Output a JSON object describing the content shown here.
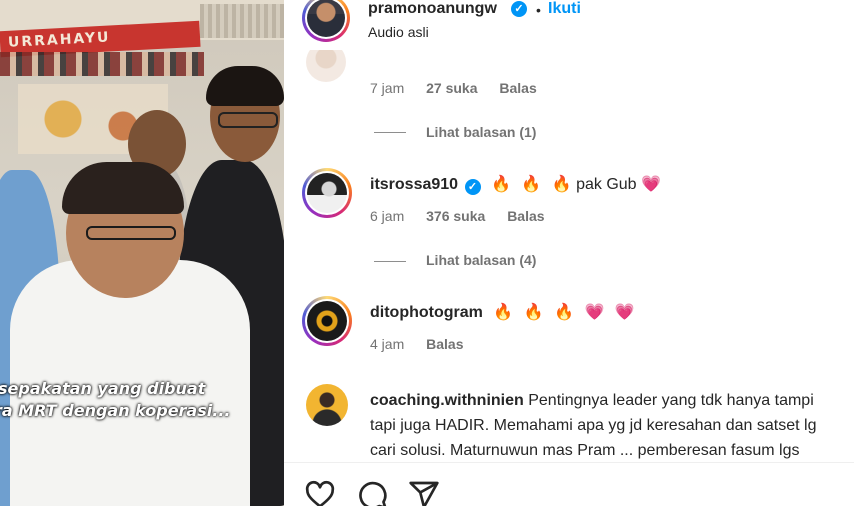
{
  "video": {
    "banner_text": "URRAHAYU",
    "subtitle_lines": [
      "sepakatan yang dibuat",
      "ra MRT dengan koperasi..."
    ]
  },
  "post": {
    "username": "pramonoanungw",
    "separator": "•",
    "follow_label": "Ikuti",
    "audio_label": "Audio asli"
  },
  "comments": [
    {
      "username": "",
      "text": "",
      "time": "7 jam",
      "likes": "27 suka",
      "reply": "Balas",
      "view_replies": "Lihat balasan (1)"
    },
    {
      "username": "itsrossa910",
      "verified": true,
      "emojis_before": [
        "🔥",
        "🔥",
        "🔥"
      ],
      "text": "pak Gub",
      "emojis_after": [
        "💗"
      ],
      "time": "6 jam",
      "likes": "376 suka",
      "reply": "Balas",
      "view_replies": "Lihat balasan (4)"
    },
    {
      "username": "ditophotogram",
      "emojis_after": [
        "🔥",
        "🔥",
        "🔥",
        "💗",
        "💗"
      ],
      "time": "4 jam",
      "reply": "Balas"
    },
    {
      "username": "coaching.withninien",
      "text_lines": [
        "Pentingnya leader yang tdk hanya tampi",
        "tapi juga HADIR. Memahami apa yg jd keresahan dan satset lg",
        "cari solusi. Maturnuwun mas Pram ... pemberesan fasum lgs"
      ]
    }
  ],
  "actions": {
    "like_icon": "heart-icon",
    "comment_icon": "comment-icon",
    "share_icon": "share-icon"
  },
  "colors": {
    "accent_blue": "#0095f6",
    "text": "#262626",
    "muted": "#737373",
    "heart_pink": "#ff3c73",
    "flame": "#f26b1d"
  }
}
